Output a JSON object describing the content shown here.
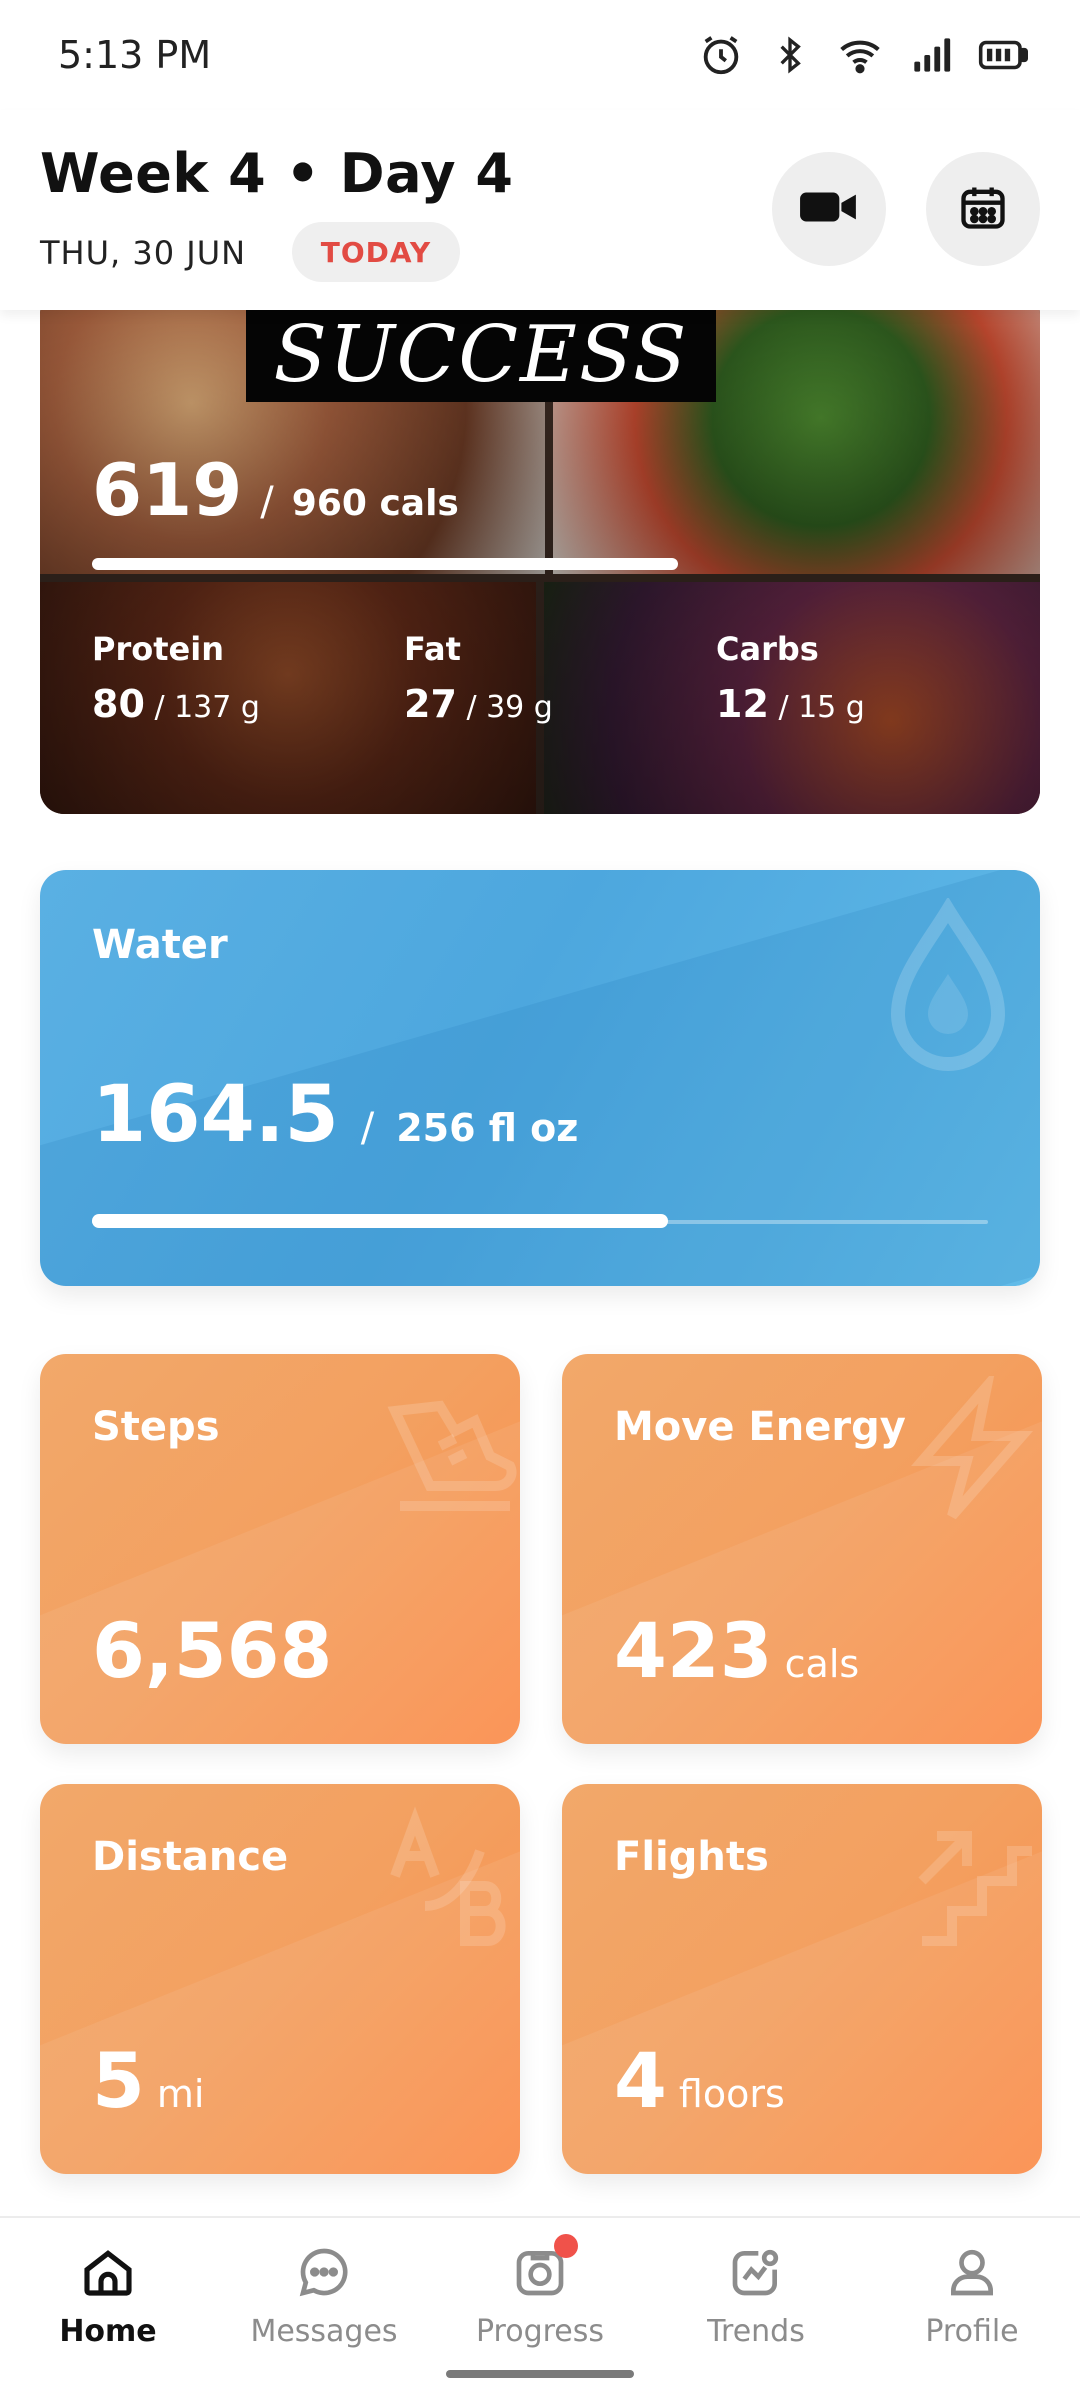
{
  "status_bar": {
    "time": "5:13 PM"
  },
  "header": {
    "title": "Week 4 • Day 4",
    "date": "THU, 30 JUN",
    "badge": "TODAY"
  },
  "nutrition": {
    "banner_text": "SUCCESS",
    "calories_value": "619",
    "calories_slash": "/",
    "calories_goal": "960 cals",
    "calories_progress": 0.645,
    "macros": [
      {
        "label": "Protein",
        "value": "80",
        "goal": "/ 137 g"
      },
      {
        "label": "Fat",
        "value": "27",
        "goal": "/ 39 g"
      },
      {
        "label": "Carbs",
        "value": "12",
        "goal": "/ 15 g"
      }
    ]
  },
  "water": {
    "title": "Water",
    "value": "164.5",
    "slash": "/",
    "goal": "256 fl oz",
    "progress": 0.6426
  },
  "tiles": {
    "steps": {
      "title": "Steps",
      "value": "6,568",
      "unit": "",
      "icon": "shoe-icon"
    },
    "move": {
      "title": "Move Energy",
      "value": "423",
      "unit": "cals",
      "icon": "lightning-icon"
    },
    "distance": {
      "title": "Distance",
      "value": "5",
      "unit": "mi",
      "icon": "a-to-b-icon"
    },
    "flights": {
      "title": "Flights",
      "value": "4",
      "unit": "floors",
      "icon": "stairs-icon"
    }
  },
  "nav": [
    {
      "label": "Home",
      "icon": "home-icon",
      "active": true
    },
    {
      "label": "Messages",
      "icon": "chat-icon",
      "active": false
    },
    {
      "label": "Progress",
      "icon": "camera-icon",
      "active": false,
      "notification": true
    },
    {
      "label": "Trends",
      "icon": "trends-icon",
      "active": false
    },
    {
      "label": "Profile",
      "icon": "person-icon",
      "active": false
    }
  ],
  "colors": {
    "accent_red": "#e24b43",
    "water_blue": "#4da7de",
    "tile_orange": "#f3a060"
  }
}
